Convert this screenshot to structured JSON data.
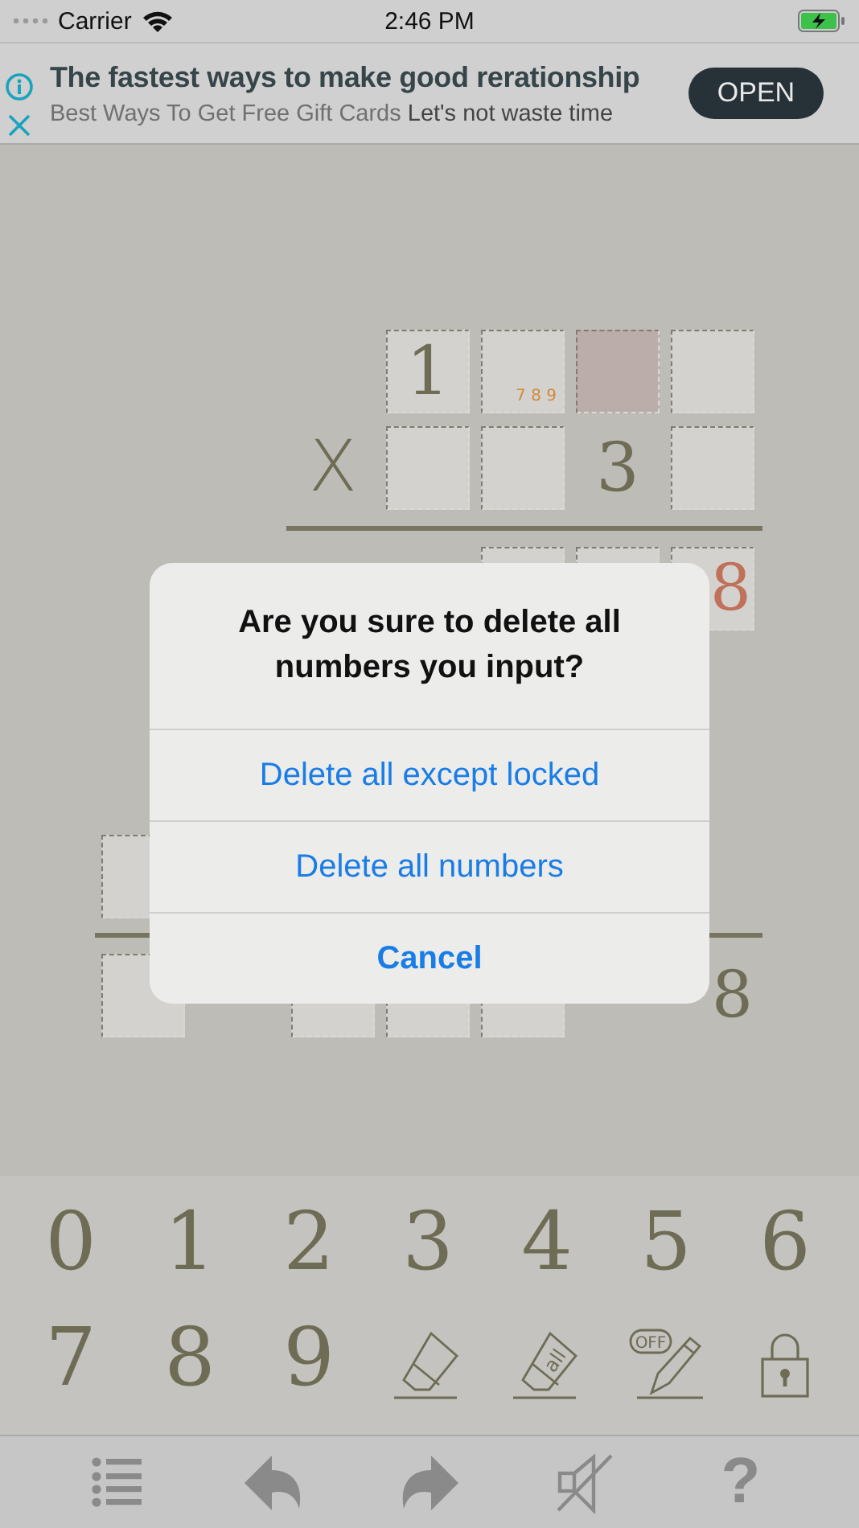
{
  "status_bar": {
    "carrier": "Carrier",
    "time": "2:46 PM"
  },
  "ad": {
    "headline": "The fastest ways to make good rerationship",
    "description": "Best Ways To Get Free Gift Cards",
    "tagline": "Let's not waste time",
    "button": "OPEN"
  },
  "board": {
    "sections": [
      {
        "rows": [
          [
            {
              "kind": "empty"
            },
            {
              "kind": "empty"
            },
            {
              "kind": "empty"
            },
            {
              "kind": "box",
              "value": "1",
              "selected": false,
              "conflict": false
            },
            {
              "kind": "box",
              "note": "7 8 9",
              "selected": false
            },
            {
              "kind": "box",
              "selected": true
            },
            {
              "kind": "box",
              "selected": false
            }
          ],
          [
            {
              "kind": "empty"
            },
            {
              "kind": "empty"
            },
            {
              "kind": "sign",
              "value": "X"
            },
            {
              "kind": "box",
              "selected": false
            },
            {
              "kind": "box",
              "selected": false
            },
            {
              "kind": "given",
              "value": "3"
            },
            {
              "kind": "box",
              "selected": false
            }
          ]
        ]
      },
      {
        "rows": [
          [
            {
              "kind": "empty"
            },
            {
              "kind": "empty"
            },
            {
              "kind": "empty"
            },
            {
              "kind": "empty"
            },
            {
              "kind": "box",
              "selected": false
            },
            {
              "kind": "box",
              "selected": false
            },
            {
              "kind": "box",
              "value": "8",
              "selected": false,
              "conflict": true
            }
          ],
          [
            {
              "kind": "box",
              "selected": false
            },
            {
              "kind": "empty"
            },
            {
              "kind": "empty"
            },
            {
              "kind": "empty"
            },
            {
              "kind": "empty"
            },
            {
              "kind": "empty"
            },
            {
              "kind": "empty"
            }
          ]
        ]
      },
      {
        "rows": [
          [
            {
              "kind": "box",
              "selected": false
            },
            {
              "kind": "empty"
            },
            {
              "kind": "box",
              "selected": false
            },
            {
              "kind": "box",
              "selected": false
            },
            {
              "kind": "box",
              "selected": false
            },
            {
              "kind": "empty"
            },
            {
              "kind": "given",
              "value": "8"
            }
          ]
        ]
      }
    ]
  },
  "dialog": {
    "title": "Are you sure to delete all numbers you input?",
    "actions": [
      {
        "label": "Delete all except locked",
        "kind": "default"
      },
      {
        "label": "Delete all numbers",
        "kind": "default"
      },
      {
        "label": "Cancel",
        "kind": "cancel"
      }
    ]
  },
  "keypad": [
    {
      "kind": "digit",
      "label": "0"
    },
    {
      "kind": "digit",
      "label": "1"
    },
    {
      "kind": "digit",
      "label": "2"
    },
    {
      "kind": "digit",
      "label": "3"
    },
    {
      "kind": "digit",
      "label": "4"
    },
    {
      "kind": "digit",
      "label": "5"
    },
    {
      "kind": "digit",
      "label": "6"
    },
    {
      "kind": "digit",
      "label": "7"
    },
    {
      "kind": "digit",
      "label": "8"
    },
    {
      "kind": "digit",
      "label": "9"
    },
    {
      "kind": "eraser"
    },
    {
      "kind": "eraser-all",
      "label": "all"
    },
    {
      "kind": "pencil",
      "label": "OFF"
    },
    {
      "kind": "lock"
    }
  ],
  "toolbar": [
    {
      "kind": "list"
    },
    {
      "kind": "undo"
    },
    {
      "kind": "redo"
    },
    {
      "kind": "mute"
    },
    {
      "kind": "text",
      "label": "?"
    }
  ]
}
